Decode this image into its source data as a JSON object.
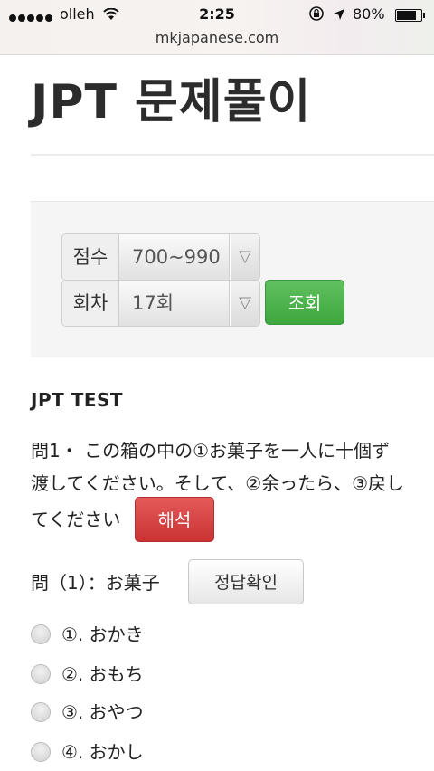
{
  "status_bar": {
    "carrier": "olleh",
    "time": "2:25",
    "battery": "80%",
    "battery_level": 0.8,
    "icons": [
      "signal-dots-icon",
      "wifi-icon",
      "rotation-lock-icon",
      "location-arrow-icon",
      "battery-icon"
    ]
  },
  "browser": {
    "url": "mkjapanese.com"
  },
  "page": {
    "title": "JPT 문제풀이"
  },
  "filters": {
    "score": {
      "label": "점수",
      "value": "700~990"
    },
    "round": {
      "label": "회차",
      "value": "17회"
    },
    "dropdown_arrow": "▽",
    "search_button": "조회"
  },
  "section": {
    "heading": "JPT TEST"
  },
  "question": {
    "line1": "問1・ この箱の中の①お菓子を一人に十個ず",
    "line2": "渡してください。そして、②余ったら、③戻し",
    "line3": "てください",
    "translate_button": "해석"
  },
  "sub_question": {
    "label": "問（1）：お菓子",
    "answer_button": "정답확인"
  },
  "options": [
    {
      "label": "①. おかき"
    },
    {
      "label": "②. おもち"
    },
    {
      "label": "③. おやつ"
    },
    {
      "label": "④. おかし"
    }
  ],
  "colors": {
    "success": "#4cae4c",
    "danger": "#d9534f",
    "panel_bg": "#f5f5f5"
  }
}
